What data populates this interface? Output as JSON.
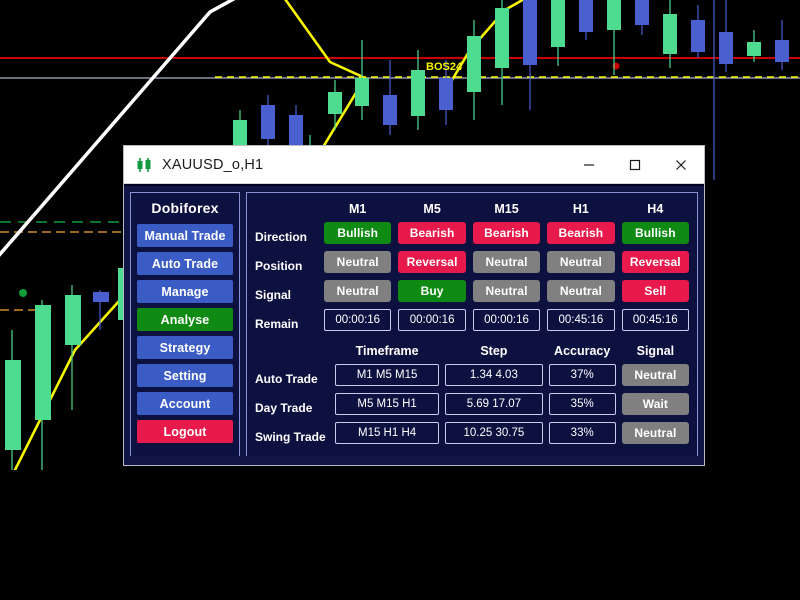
{
  "window": {
    "title": "XAUUSD_o,H1",
    "icon": "candlestick-icon",
    "controls": {
      "minimize": "minimize-icon",
      "maximize": "maximize-icon",
      "close": "close-icon"
    }
  },
  "sidebar": {
    "brand": "Dobiforex",
    "items": [
      {
        "label": "Manual Trade",
        "state": "normal"
      },
      {
        "label": "Auto Trade",
        "state": "normal"
      },
      {
        "label": "Manage",
        "state": "normal"
      },
      {
        "label": "Analyse",
        "state": "active"
      },
      {
        "label": "Strategy",
        "state": "normal"
      },
      {
        "label": "Setting",
        "state": "normal"
      },
      {
        "label": "Account",
        "state": "normal"
      },
      {
        "label": "Logout",
        "state": "danger"
      }
    ]
  },
  "analysis": {
    "timeframes": [
      "M1",
      "M5",
      "M15",
      "H1",
      "H4"
    ],
    "rows": [
      {
        "label": "Direction",
        "values": [
          "Bullish",
          "Bearish",
          "Bearish",
          "Bearish",
          "Bullish"
        ],
        "styles": [
          "green",
          "red",
          "red",
          "red",
          "green"
        ]
      },
      {
        "label": "Position",
        "values": [
          "Neutral",
          "Reversal",
          "Neutral",
          "Neutral",
          "Reversal"
        ],
        "styles": [
          "gray",
          "red",
          "gray",
          "gray",
          "red"
        ]
      },
      {
        "label": "Signal",
        "values": [
          "Neutral",
          "Buy",
          "Neutral",
          "Neutral",
          "Sell"
        ],
        "styles": [
          "gray",
          "green",
          "gray",
          "gray",
          "red"
        ]
      }
    ],
    "remain": {
      "label": "Remain",
      "values": [
        "00:00:16",
        "00:00:16",
        "00:00:16",
        "00:45:16",
        "00:45:16"
      ]
    }
  },
  "strategies": {
    "headers": [
      "Timeframe",
      "Step",
      "Accuracy",
      "Signal"
    ],
    "rows": [
      {
        "label": "Auto Trade",
        "timeframe": "M1  M5  M15",
        "step": "1.34 4.03",
        "accuracy": "37%",
        "signal": "Neutral",
        "signal_style": "gray"
      },
      {
        "label": "Day Trade",
        "timeframe": "M5  M15  H1",
        "step": "5.69 17.07",
        "accuracy": "35%",
        "signal": "Wait",
        "signal_style": "gray"
      },
      {
        "label": "Swing Trade",
        "timeframe": "M15  H1  H4",
        "step": "10.25 30.75",
        "accuracy": "33%",
        "signal": "Neutral",
        "signal_style": "gray"
      }
    ]
  },
  "chart": {
    "annotation_label": "BOS24",
    "colors": {
      "bull_candle": "#4ddb8f",
      "bear_candle": "#4a5fd0",
      "resistance_line": "#cc0000",
      "level_line": "#aab4cc",
      "trend_line": "#ffffff",
      "zigzag_line": "#f5f500",
      "dashed_green": "#0f9e3a",
      "dashed_orange": "#d08a2a",
      "background": "#000000"
    }
  }
}
